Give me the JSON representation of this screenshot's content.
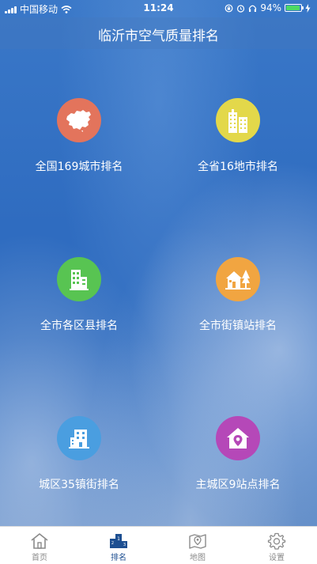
{
  "status_bar": {
    "carrier": "中国移动",
    "time": "11:24",
    "battery": "94%",
    "battery_level": 0.94
  },
  "header": {
    "title": "临沂市空气质量排名"
  },
  "menu": [
    {
      "label": "全国169城市排名",
      "color": "#e3745c",
      "icon": "china-map-icon"
    },
    {
      "label": "全省16地市排名",
      "color": "#e3d84a",
      "icon": "city-buildings-icon"
    },
    {
      "label": "全市各区县排名",
      "color": "#58c452",
      "icon": "district-building-icon"
    },
    {
      "label": "全市街镇站排名",
      "color": "#f1a541",
      "icon": "house-tree-icon"
    },
    {
      "label": "城区35镇街排名",
      "color": "#4a9ee0",
      "icon": "office-building-icon"
    },
    {
      "label": "主城区9站点排名",
      "color": "#b548b8",
      "icon": "house-pin-icon"
    }
  ],
  "tabs": [
    {
      "label": "首页",
      "icon": "home-icon"
    },
    {
      "label": "排名",
      "icon": "podium-icon"
    },
    {
      "label": "地图",
      "icon": "map-pin-icon"
    },
    {
      "label": "设置",
      "icon": "gear-icon"
    }
  ],
  "active_tab": "排名"
}
